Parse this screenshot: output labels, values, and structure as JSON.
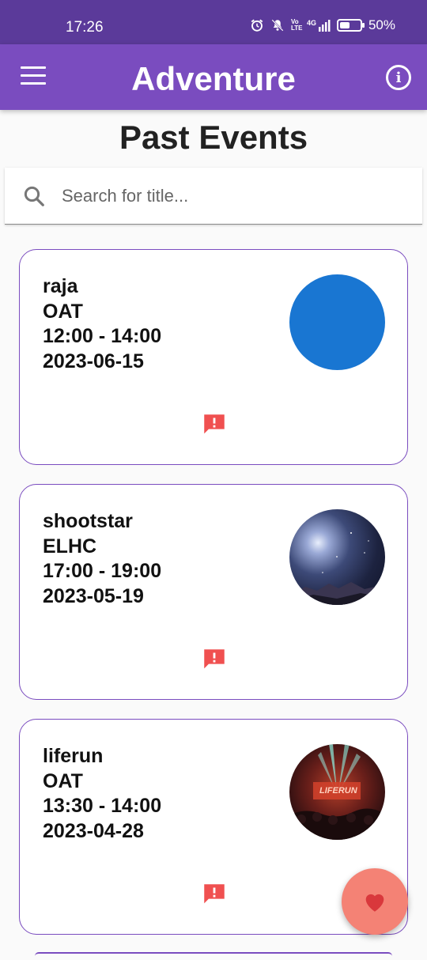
{
  "status_bar": {
    "time": "17:26",
    "network": "4G",
    "volte": "Vo LTE",
    "battery_text": "50%",
    "battery_level": 0.5
  },
  "app_bar": {
    "title": "Adventure",
    "menu_icon": "menu-icon",
    "info_icon": "info-icon",
    "info_glyph": "i"
  },
  "page": {
    "title": "Past Events"
  },
  "search": {
    "placeholder": "Search for title...",
    "value": ""
  },
  "events": [
    {
      "title": "raja",
      "venue": "OAT",
      "time": "12:00 - 14:00",
      "date": "2023-06-15",
      "image": "blue-circle"
    },
    {
      "title": "shootstar",
      "venue": "ELHC",
      "time": "17:00 - 19:00",
      "date": "2023-05-19",
      "image": "night-sky-photo"
    },
    {
      "title": "liferun",
      "venue": "OAT",
      "time": "13:30 - 14:00",
      "date": "2023-04-28",
      "image": "concert-stage-photo",
      "image_text": "LIFERUN"
    }
  ],
  "colors": {
    "status_bar": "#5b3a9a",
    "app_bar": "#7a4cbf",
    "card_border": "#7a4cbf",
    "report_icon": "#f05050",
    "fab": "#f48275",
    "blue_circle": "#1976d2"
  },
  "fab": {
    "icon": "heart-icon"
  }
}
